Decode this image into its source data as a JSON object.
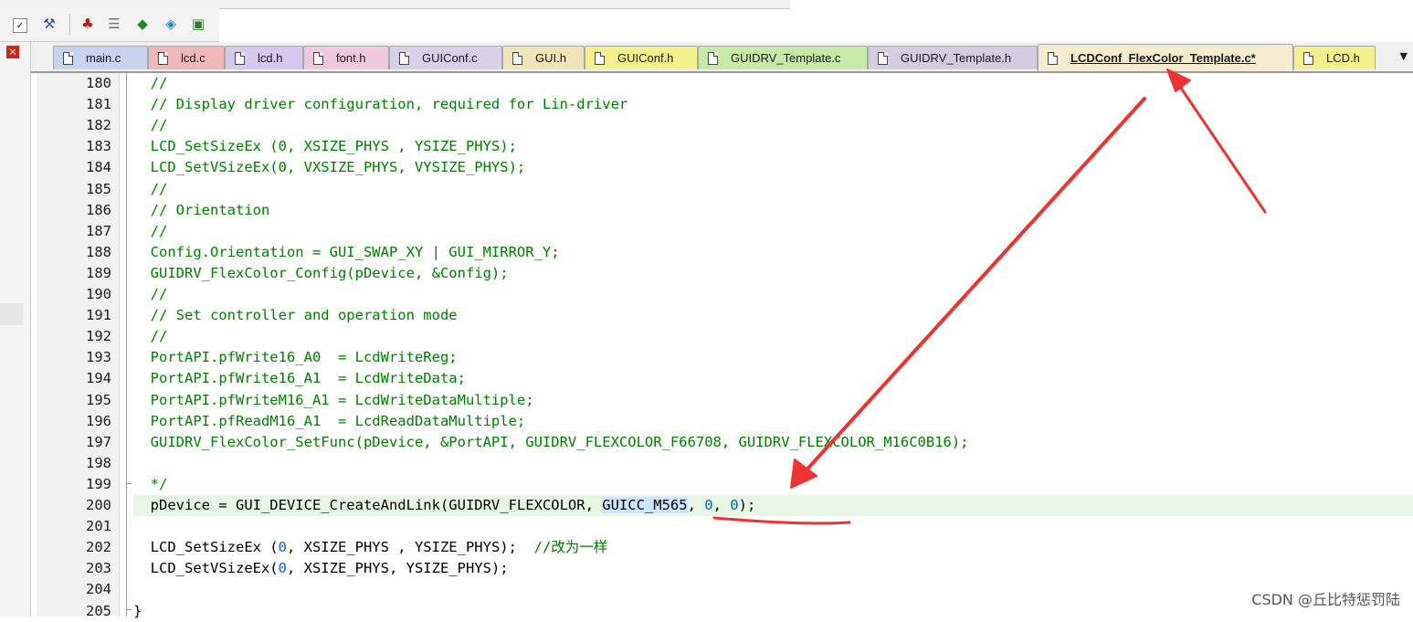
{
  "tabs": [
    {
      "label": "main.c",
      "color": "#c8d4ee"
    },
    {
      "label": "lcd.c",
      "color": "#f0b8b8"
    },
    {
      "label": "lcd.h",
      "color": "#d6c8ee"
    },
    {
      "label": "font.h",
      "color": "#eec8dc"
    },
    {
      "label": "GUIConf.c",
      "color": "#d8d0e8"
    },
    {
      "label": "GUI.h",
      "color": "#f0e4b8"
    },
    {
      "label": "GUIConf.h",
      "color": "#f4f08c"
    },
    {
      "label": "GUIDRV_Template.c",
      "color": "#c8eaa8"
    },
    {
      "label": "GUIDRV_Template.h",
      "color": "#d4cce0"
    },
    {
      "label": "LCDConf_FlexColor_Template.c*",
      "color": "#f6ecd0"
    },
    {
      "label": "LCD.h",
      "color": "#f4f08c"
    }
  ],
  "active_tab": "LCDConf_FlexColor_Template.c*",
  "code_lines": [
    {
      "n": "180",
      "text": "  //",
      "kind": "comment"
    },
    {
      "n": "181",
      "text": "  // Display driver configuration, required for Lin-driver",
      "kind": "comment"
    },
    {
      "n": "182",
      "text": "  //",
      "kind": "comment"
    },
    {
      "n": "183",
      "text": "  LCD_SetSizeEx (0, XSIZE_PHYS , YSIZE_PHYS);",
      "kind": "comment"
    },
    {
      "n": "184",
      "text": "  LCD_SetVSizeEx(0, VXSIZE_PHYS, VYSIZE_PHYS);",
      "kind": "comment"
    },
    {
      "n": "185",
      "text": "  //",
      "kind": "comment"
    },
    {
      "n": "186",
      "text": "  // Orientation",
      "kind": "comment"
    },
    {
      "n": "187",
      "text": "  //",
      "kind": "comment"
    },
    {
      "n": "188",
      "text": "  Config.Orientation = GUI_SWAP_XY | GUI_MIRROR_Y;",
      "kind": "comment"
    },
    {
      "n": "189",
      "text": "  GUIDRV_FlexColor_Config(pDevice, &Config);",
      "kind": "comment"
    },
    {
      "n": "190",
      "text": "  //",
      "kind": "comment"
    },
    {
      "n": "191",
      "text": "  // Set controller and operation mode",
      "kind": "comment"
    },
    {
      "n": "192",
      "text": "  //",
      "kind": "comment"
    },
    {
      "n": "193",
      "text": "  PortAPI.pfWrite16_A0  = LcdWriteReg;",
      "kind": "comment"
    },
    {
      "n": "194",
      "text": "  PortAPI.pfWrite16_A1  = LcdWriteData;",
      "kind": "comment"
    },
    {
      "n": "195",
      "text": "  PortAPI.pfWriteM16_A1 = LcdWriteDataMultiple;",
      "kind": "comment"
    },
    {
      "n": "196",
      "text": "  PortAPI.pfReadM16_A1  = LcdReadDataMultiple;",
      "kind": "comment"
    },
    {
      "n": "197",
      "text": "  GUIDRV_FlexColor_SetFunc(pDevice, &PortAPI, GUIDRV_FLEXCOLOR_F66708, GUIDRV_FLEXCOLOR_M16C0B16);",
      "kind": "comment"
    },
    {
      "n": "198",
      "text": "",
      "kind": "comment"
    },
    {
      "n": "199",
      "text": "  */",
      "kind": "comment"
    },
    {
      "n": "200",
      "text": "",
      "kind": "current"
    },
    {
      "n": "201",
      "text": "",
      "kind": "code"
    },
    {
      "n": "202",
      "text": "",
      "kind": "code"
    },
    {
      "n": "203",
      "text": "",
      "kind": "code"
    },
    {
      "n": "204",
      "text": "",
      "kind": "code"
    },
    {
      "n": "205",
      "text": "}",
      "kind": "code"
    }
  ],
  "line200": {
    "pre": "  pDevice = GUI_DEVICE_CreateAndLink(GUIDRV_FLEXCOLOR, ",
    "selected": "GUICC_M565",
    "sep1": ", ",
    "arg1": "0",
    "sep2": ", ",
    "arg2": "0",
    "post": ");"
  },
  "line202": {
    "pre": "  LCD_SetSizeEx (",
    "num": "0",
    "post": ", XSIZE_PHYS , YSIZE_PHYS);  ",
    "comment": "//改为一样"
  },
  "line203": {
    "pre": "  LCD_SetVSizeEx(",
    "num": "0",
    "post": ", XSIZE_PHYS, YSIZE_PHYS);"
  },
  "watermark": "CSDN @丘比特惩罚陆",
  "annotation_color": "#ee3333",
  "toolbar_icons": [
    "checkbox-icon",
    "wand-icon",
    "build-icon",
    "layers-icon",
    "diamond-icon",
    "download-icon",
    "package-icon"
  ]
}
